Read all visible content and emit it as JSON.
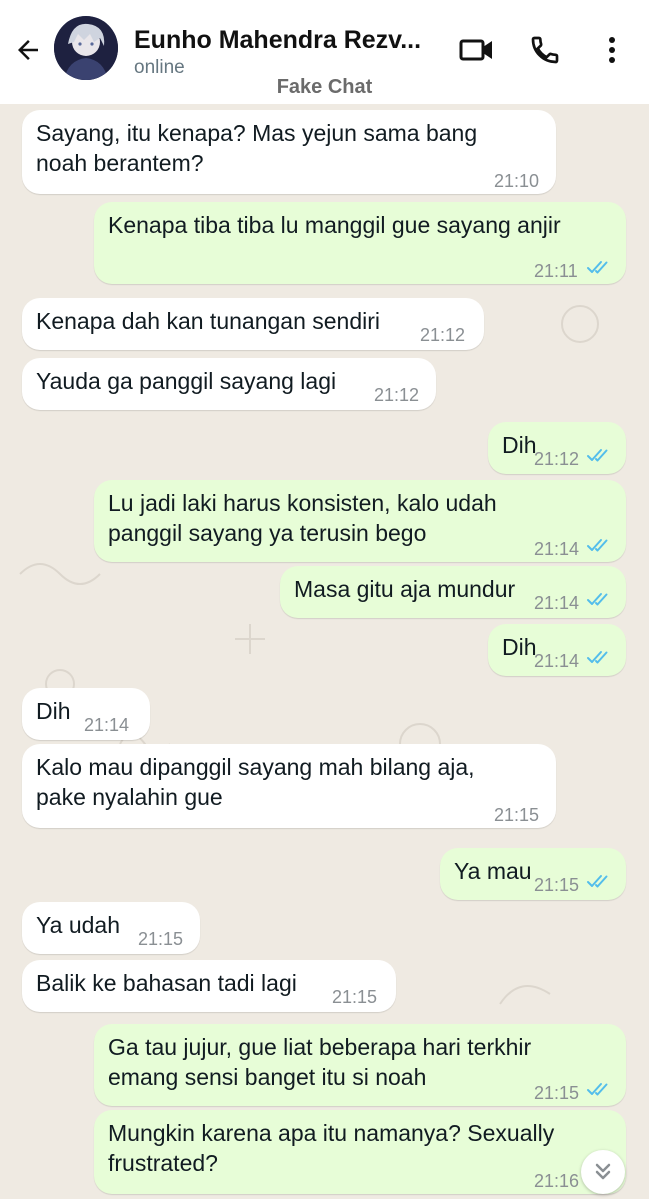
{
  "header": {
    "contact_name": "Eunho Mahendra Rezv...",
    "status": "online",
    "subtitle": "Fake Chat"
  },
  "colors": {
    "incoming_bubble": "#ffffff",
    "outgoing_bubble": "#e7fdd7",
    "chat_background": "#efeae2",
    "read_tick": "#53bdeb"
  },
  "icons": {
    "back": "arrow-left-icon",
    "video": "video-camera-icon",
    "call": "phone-icon",
    "menu": "more-vertical-icon",
    "read": "double-check-icon",
    "scroll": "double-chevron-down-icon"
  },
  "messages": [
    {
      "dir": "in",
      "lines": [
        "Sayang, itu kenapa? Mas yejun sama bang",
        "noah berantem?"
      ],
      "time": "21:10"
    },
    {
      "dir": "out",
      "lines": [
        "Kenapa tiba tiba lu manggil gue sayang anjir"
      ],
      "time": "21:11",
      "read": true
    },
    {
      "dir": "in",
      "lines": [
        "Kenapa dah kan tunangan sendiri"
      ],
      "time": "21:12"
    },
    {
      "dir": "in",
      "lines": [
        "Yauda ga panggil sayang lagi"
      ],
      "time": "21:12"
    },
    {
      "dir": "out",
      "lines": [
        "Dih"
      ],
      "time": "21:12",
      "read": true
    },
    {
      "dir": "out",
      "lines": [
        "Lu jadi laki harus konsisten, kalo udah",
        "panggil sayang ya terusin bego"
      ],
      "time": "21:14",
      "read": true
    },
    {
      "dir": "out",
      "lines": [
        "Masa gitu aja mundur"
      ],
      "time": "21:14",
      "read": true
    },
    {
      "dir": "out",
      "lines": [
        "Dih"
      ],
      "time": "21:14",
      "read": true
    },
    {
      "dir": "in",
      "lines": [
        "Dih"
      ],
      "time": "21:14"
    },
    {
      "dir": "in",
      "lines": [
        "Kalo mau dipanggil sayang mah bilang aja,",
        "pake nyalahin gue"
      ],
      "time": "21:15"
    },
    {
      "dir": "out",
      "lines": [
        "Ya mau"
      ],
      "time": "21:15",
      "read": true
    },
    {
      "dir": "in",
      "lines": [
        "Ya udah"
      ],
      "time": "21:15"
    },
    {
      "dir": "in",
      "lines": [
        "Balik ke bahasan tadi lagi"
      ],
      "time": "21:15"
    },
    {
      "dir": "out",
      "lines": [
        "Ga tau jujur, gue liat beberapa hari terkhir",
        "emang sensi banget itu si noah"
      ],
      "time": "21:15",
      "read": true
    },
    {
      "dir": "out",
      "lines": [
        "Mungkin karena apa itu namanya? Sexually",
        "frustrated?"
      ],
      "time": "21:16",
      "read": false
    }
  ]
}
